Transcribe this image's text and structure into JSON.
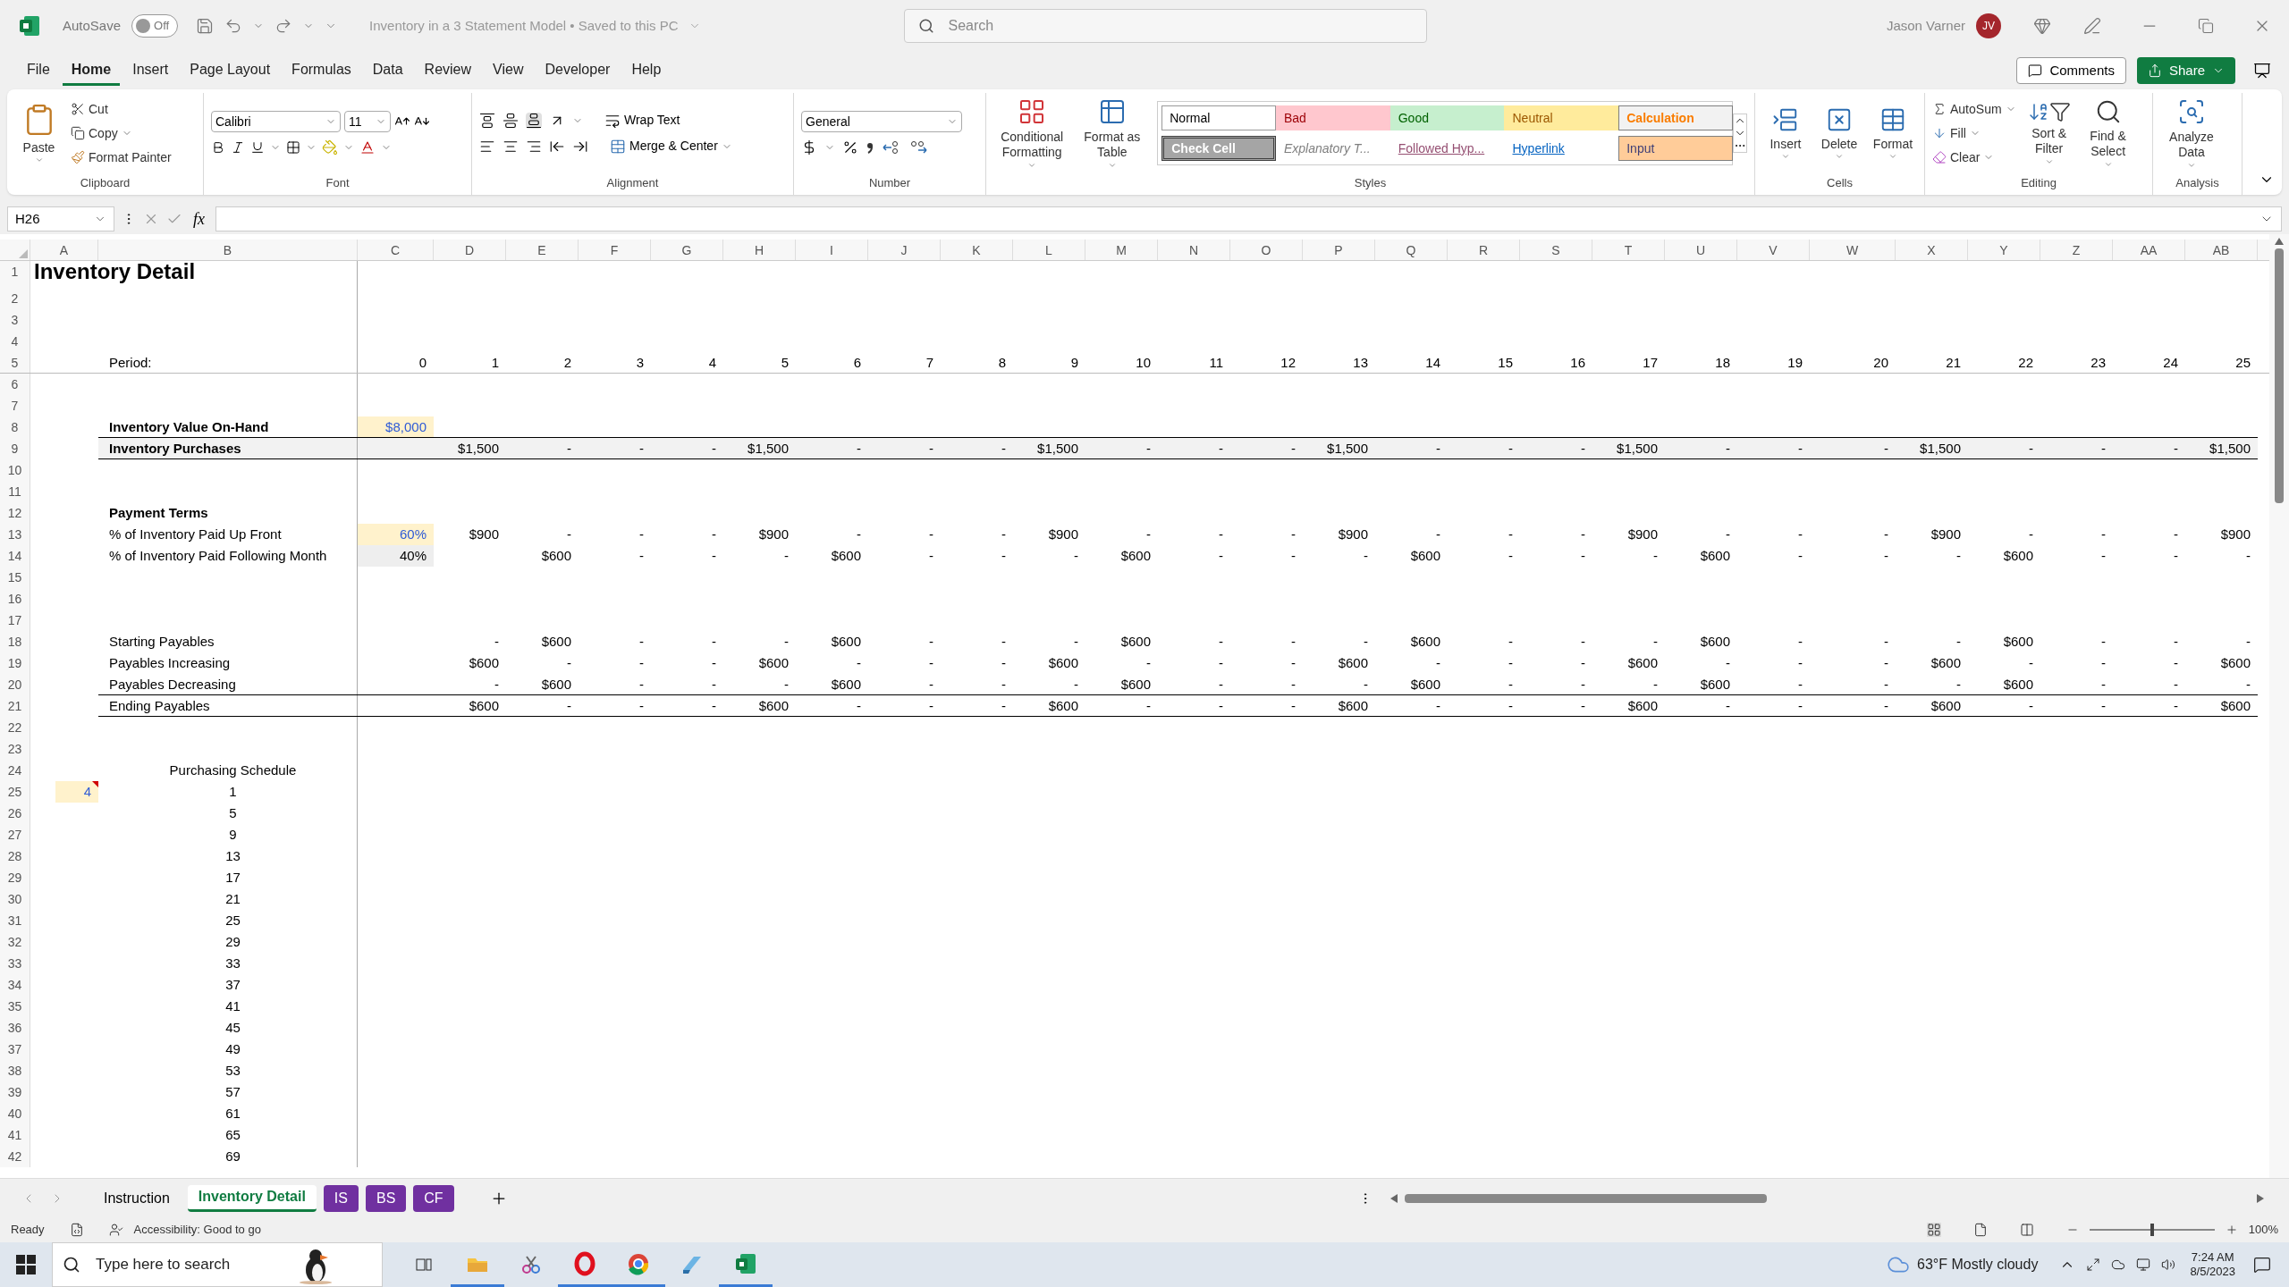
{
  "title_bar": {
    "autosave_label": "AutoSave",
    "autosave_on": false,
    "autosave_state": "Off",
    "document_title": "Inventory in a 3 Statement Model • Saved to this PC",
    "search_placeholder": "Search",
    "user_name": "Jason Varner",
    "user_initials": "JV"
  },
  "menu_tabs": [
    {
      "label": "File",
      "selected": false
    },
    {
      "label": "Home",
      "selected": true
    },
    {
      "label": "Insert",
      "selected": false
    },
    {
      "label": "Page Layout",
      "selected": false
    },
    {
      "label": "Formulas",
      "selected": false
    },
    {
      "label": "Data",
      "selected": false
    },
    {
      "label": "Review",
      "selected": false
    },
    {
      "label": "View",
      "selected": false
    },
    {
      "label": "Developer",
      "selected": false
    },
    {
      "label": "Help",
      "selected": false
    }
  ],
  "comments_button": "Comments",
  "share_button": "Share",
  "ribbon": {
    "clipboard": {
      "label": "Clipboard",
      "paste": "Paste",
      "cut": "Cut",
      "copy": "Copy",
      "format_painter": "Format Painter"
    },
    "font": {
      "label": "Font",
      "font_name": "Calibri",
      "font_size": "11"
    },
    "alignment": {
      "label": "Alignment",
      "wrap_text": "Wrap Text",
      "merge_center": "Merge & Center"
    },
    "number": {
      "label": "Number",
      "format": "General"
    },
    "styles": {
      "label": "Styles",
      "conditional_formatting": "Conditional Formatting",
      "format_as_table": "Format as Table",
      "gallery": [
        {
          "label": "Normal",
          "kind": "normal"
        },
        {
          "label": "Bad",
          "kind": "bad"
        },
        {
          "label": "Good",
          "kind": "good"
        },
        {
          "label": "Neutral",
          "kind": "neutral"
        },
        {
          "label": "Calculation",
          "kind": "calculation"
        },
        {
          "label": "Check Cell",
          "kind": "check"
        },
        {
          "label": "Explanatory T...",
          "kind": "explanatory"
        },
        {
          "label": "Followed Hyp...",
          "kind": "followed"
        },
        {
          "label": "Hyperlink",
          "kind": "hyperlink"
        },
        {
          "label": "Input",
          "kind": "input"
        }
      ]
    },
    "cells": {
      "label": "Cells",
      "buttons": [
        "Insert",
        "Delete",
        "Format"
      ]
    },
    "editing": {
      "label": "Editing",
      "autosum": "AutoSum",
      "fill": "Fill",
      "clear": "Clear",
      "sort_filter": "Sort & Filter",
      "find_select": "Find & Select"
    },
    "analysis": {
      "label": "Analysis",
      "analyze_data": "Analyze Data"
    }
  },
  "formula_bar": {
    "name_box": "H26",
    "insert_function": "fx"
  },
  "sheet": {
    "columns": [
      "A",
      "B",
      "C",
      "D",
      "E",
      "F",
      "G",
      "H",
      "I",
      "J",
      "K",
      "L",
      "M",
      "N",
      "O",
      "P",
      "Q",
      "R",
      "S",
      "T",
      "U",
      "V",
      "W",
      "X",
      "Y",
      "Z",
      "AA",
      "AB"
    ],
    "rows": [
      {
        "number": "1",
        "title": "Inventory Detail"
      },
      {
        "number": "2"
      },
      {
        "number": "3"
      },
      {
        "number": "4"
      },
      {
        "number": "5",
        "label": "Period:",
        "rule_below": true,
        "c_cell": {
          "text": "0",
          "kind": "plain"
        },
        "values": [
          "1",
          "2",
          "3",
          "4",
          "5",
          "6",
          "7",
          "8",
          "9",
          "10",
          "11",
          "12",
          "13",
          "14",
          "15",
          "16",
          "17",
          "18",
          "19",
          "20",
          "21",
          "22",
          "23",
          "24",
          "25"
        ]
      },
      {
        "number": "6"
      },
      {
        "number": "7"
      },
      {
        "number": "8",
        "label": "Inventory Value On-Hand",
        "bold": true,
        "border_bottom": true,
        "c_cell": {
          "text": "$8,000",
          "kind": "input"
        }
      },
      {
        "number": "9",
        "label": "Inventory Purchases",
        "bold": true,
        "shaded": true,
        "border_bottom": true,
        "values": [
          "$1,500",
          "-",
          "-",
          "-",
          "$1,500",
          "-",
          "-",
          "-",
          "$1,500",
          "-",
          "-",
          "-",
          "$1,500",
          "-",
          "-",
          "-",
          "$1,500",
          "-",
          "-",
          "-",
          "$1,500",
          "-",
          "-",
          "-",
          "$1,500"
        ]
      },
      {
        "number": "10"
      },
      {
        "number": "11"
      },
      {
        "number": "12",
        "label": "Payment Terms",
        "bold": true
      },
      {
        "number": "13",
        "label": "% of Inventory Paid Up Front",
        "c_cell": {
          "text": "60%",
          "kind": "input"
        },
        "values": [
          "$900",
          "-",
          "-",
          "-",
          "$900",
          "-",
          "-",
          "-",
          "$900",
          "-",
          "-",
          "-",
          "$900",
          "-",
          "-",
          "-",
          "$900",
          "-",
          "-",
          "-",
          "$900",
          "-",
          "-",
          "-",
          "$900"
        ]
      },
      {
        "number": "14",
        "label": "% of Inventory Paid Following Month",
        "c_cell": {
          "text": "40%",
          "kind": "assumption"
        },
        "skip_first": true,
        "values": [
          "$600",
          "-",
          "-",
          "-",
          "$600",
          "-",
          "-",
          "-",
          "$600",
          "-",
          "-",
          "-",
          "$600",
          "-",
          "-",
          "-",
          "$600",
          "-",
          "-",
          "-",
          "$600",
          "-",
          "-",
          "-"
        ]
      },
      {
        "number": "15"
      },
      {
        "number": "16"
      },
      {
        "number": "17"
      },
      {
        "number": "18",
        "label": "Starting Payables",
        "values": [
          "-",
          "$600",
          "-",
          "-",
          "-",
          "$600",
          "-",
          "-",
          "-",
          "$600",
          "-",
          "-",
          "-",
          "$600",
          "-",
          "-",
          "-",
          "$600",
          "-",
          "-",
          "-",
          "$600",
          "-",
          "-",
          "-"
        ]
      },
      {
        "number": "19",
        "label": "Payables Increasing",
        "values": [
          "$600",
          "-",
          "-",
          "-",
          "$600",
          "-",
          "-",
          "-",
          "$600",
          "-",
          "-",
          "-",
          "$600",
          "-",
          "-",
          "-",
          "$600",
          "-",
          "-",
          "-",
          "$600",
          "-",
          "-",
          "-",
          "$600"
        ]
      },
      {
        "number": "20",
        "label": "Payables Decreasing",
        "border_bottom": true,
        "values": [
          "-",
          "$600",
          "-",
          "-",
          "-",
          "$600",
          "-",
          "-",
          "-",
          "$600",
          "-",
          "-",
          "-",
          "$600",
          "-",
          "-",
          "-",
          "$600",
          "-",
          "-",
          "-",
          "$600",
          "-",
          "-",
          "-"
        ]
      },
      {
        "number": "21",
        "label": "Ending Payables",
        "border_bottom": true,
        "values": [
          "$600",
          "-",
          "-",
          "-",
          "$600",
          "-",
          "-",
          "-",
          "$600",
          "-",
          "-",
          "-",
          "$600",
          "-",
          "-",
          "-",
          "$600",
          "-",
          "-",
          "-",
          "$600",
          "-",
          "-",
          "-",
          "$600"
        ]
      },
      {
        "number": "22"
      },
      {
        "number": "23"
      },
      {
        "number": "24",
        "label": "Purchasing Schedule",
        "centered": true
      },
      {
        "number": "25",
        "a": "4",
        "a_comment": true,
        "label": "1",
        "centered": true
      },
      {
        "number": "26",
        "label": "5",
        "centered": true
      },
      {
        "number": "27",
        "label": "9",
        "centered": true
      },
      {
        "number": "28",
        "label": "13",
        "centered": true
      },
      {
        "number": "29",
        "label": "17",
        "centered": true
      },
      {
        "number": "30",
        "label": "21",
        "centered": true
      },
      {
        "number": "31",
        "label": "25",
        "centered": true
      },
      {
        "number": "32",
        "label": "29",
        "centered": true
      },
      {
        "number": "33",
        "label": "33",
        "centered": true
      },
      {
        "number": "34",
        "label": "37",
        "centered": true
      },
      {
        "number": "35",
        "label": "41",
        "centered": true
      },
      {
        "number": "36",
        "label": "45",
        "centered": true
      },
      {
        "number": "37",
        "label": "49",
        "centered": true
      },
      {
        "number": "38",
        "label": "53",
        "centered": true
      },
      {
        "number": "39",
        "label": "57",
        "centered": true
      },
      {
        "number": "40",
        "label": "61",
        "centered": true
      },
      {
        "number": "41",
        "label": "65",
        "centered": true
      },
      {
        "number": "42",
        "label": "69",
        "centered": true
      }
    ]
  },
  "sheet_tabs": [
    {
      "label": "Instruction",
      "selected": false
    },
    {
      "label": "Inventory Detail",
      "selected": true
    },
    {
      "label": "IS",
      "selected": false,
      "color": "#7030a0"
    },
    {
      "label": "BS",
      "selected": false,
      "color": "#7030a0"
    },
    {
      "label": "CF",
      "selected": false,
      "color": "#7030a0"
    }
  ],
  "status_bar": {
    "status": "Ready",
    "accessibility": "Accessibility: Good to go",
    "zoom": "100%",
    "zoom_slider": {
      "level": 0.5
    }
  },
  "taskbar": {
    "search_placeholder": "Type here to search",
    "weather": "63°F Mostly cloudy",
    "time": "7:24 AM",
    "date": "8/5/2023"
  }
}
